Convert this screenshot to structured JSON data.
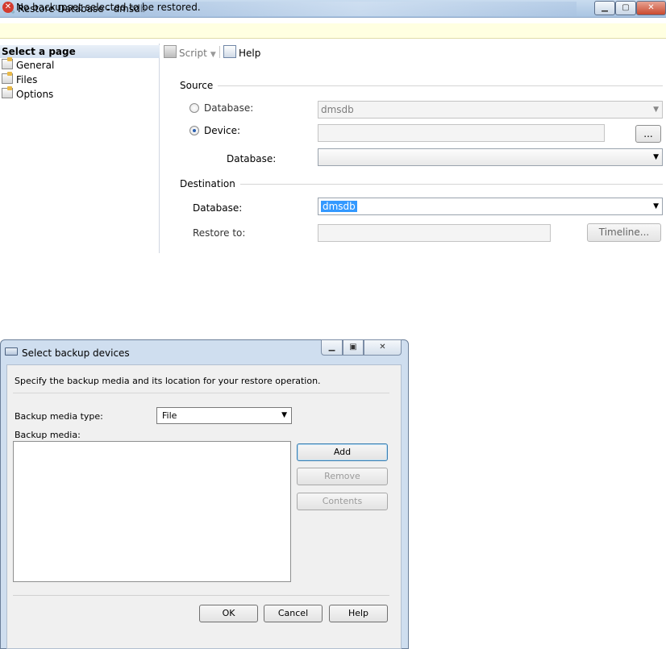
{
  "restore_window": {
    "title": "Restore Database - dmsdb",
    "error_message": "No backupset selected to be restored.",
    "select_page": {
      "header": "Select a page",
      "items": [
        "General",
        "Files",
        "Options"
      ]
    },
    "toolbar": {
      "script_label": "Script",
      "help_label": "Help"
    },
    "source": {
      "section_label": "Source",
      "database_radio_label": "Database:",
      "database_value": "dmsdb",
      "device_radio_label": "Device:",
      "device_value": "",
      "browse_label": "...",
      "device_database_label": "Database:",
      "device_database_value": "",
      "selected_option": "Device"
    },
    "destination": {
      "section_label": "Destination",
      "database_label": "Database:",
      "database_value": "dmsdb",
      "restore_to_label": "Restore to:",
      "restore_to_value": "",
      "timeline_label": "Timeline..."
    }
  },
  "backup_dialog": {
    "title": "Select backup devices",
    "instruction": "Specify the backup media and its location for your restore operation.",
    "media_type_label": "Backup media type:",
    "media_type_value": "File",
    "media_label": "Backup media:",
    "media_items": [],
    "buttons": {
      "add": "Add",
      "remove": "Remove",
      "contents": "Contents",
      "ok": "OK",
      "cancel": "Cancel",
      "help": "Help"
    }
  },
  "icons": {
    "error": "error-icon",
    "page": "page-icon",
    "script": "script-icon",
    "help": "help-icon"
  }
}
